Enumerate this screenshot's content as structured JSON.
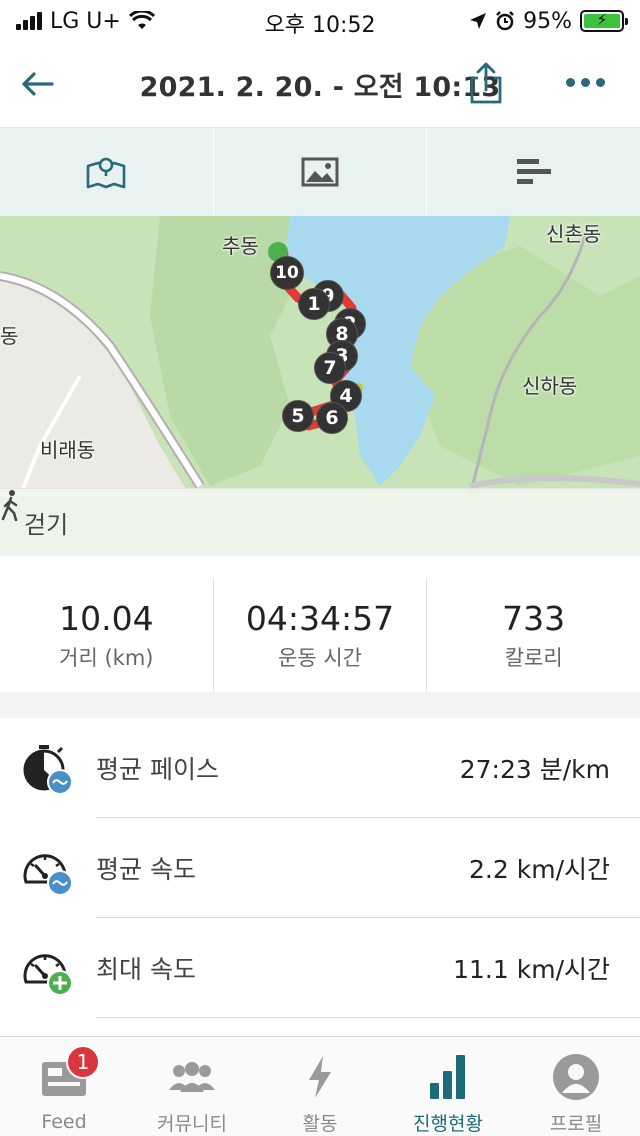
{
  "status_bar": {
    "carrier": "LG U+",
    "time": "오후 10:52",
    "battery": "95%"
  },
  "header": {
    "title": "2021. 2. 20. - 오전 10:13"
  },
  "view_tabs": [
    {
      "name": "map",
      "icon": "map-icon"
    },
    {
      "name": "photos",
      "icon": "image-icon"
    },
    {
      "name": "splits",
      "icon": "bars-icon"
    }
  ],
  "map": {
    "place_labels": [
      "추동",
      "신촌동",
      "동",
      "신하동",
      "비래동"
    ],
    "lap_markers": [
      "10",
      "9",
      "1",
      "2",
      "8",
      "3",
      "7",
      "4",
      "5",
      "6"
    ],
    "activity_type": "걷기"
  },
  "stats": [
    {
      "value": "10.04",
      "label": "거리 (km)"
    },
    {
      "value": "04:34:57",
      "label": "운동 시간"
    },
    {
      "value": "733",
      "label": "칼로리"
    }
  ],
  "metrics": [
    {
      "label": "평균 페이스",
      "value": "27:23 분/km"
    },
    {
      "label": "평균 속도",
      "value": "2.2 km/시간"
    },
    {
      "label": "최대 속도",
      "value": "11.1 km/시간"
    }
  ],
  "bottom_nav": {
    "feed": {
      "label": "Feed",
      "badge": "1"
    },
    "community": {
      "label": "커뮤니티"
    },
    "activity": {
      "label": "활동"
    },
    "progress": {
      "label": "진행현황"
    },
    "profile": {
      "label": "프로필"
    }
  },
  "colors": {
    "accent": "#1f6a78",
    "route": "#e53935",
    "water": "#a9d9ef",
    "tab_bg": "#e8f2f0",
    "badge": "#d9363e"
  }
}
